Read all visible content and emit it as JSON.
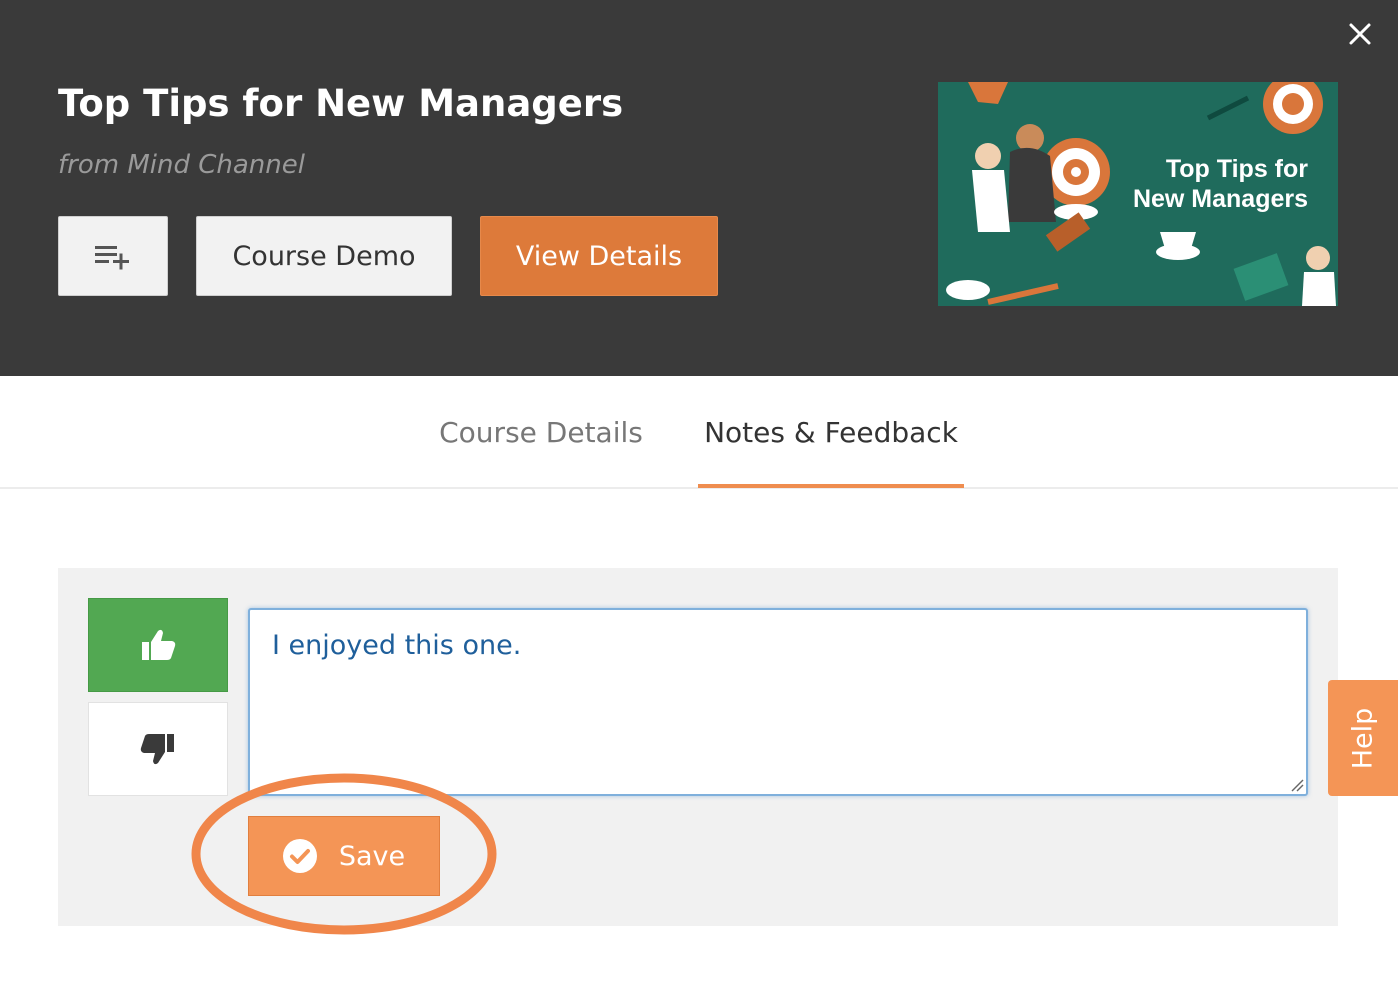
{
  "header": {
    "title": "Top Tips for New Managers",
    "source": "from Mind Channel",
    "add_to_list_icon": "playlist-add-icon",
    "demo_label": "Course Demo",
    "details_label": "View Details",
    "close_icon": "close-icon",
    "thumbnail": {
      "line1": "Top Tips for",
      "line2": "New Managers"
    }
  },
  "tabs": [
    {
      "label": "Course Details",
      "active": false
    },
    {
      "label": "Notes & Feedback",
      "active": true
    }
  ],
  "feedback": {
    "thumbs_up_icon": "thumbs-up-icon",
    "thumbs_down_icon": "thumbs-down-icon",
    "selected_vote": "up",
    "note_value": "I enjoyed this one.",
    "save_label": "Save"
  },
  "help_label": "Help",
  "colors": {
    "header_bg": "#3a3a3a",
    "accent_orange": "#dd7a3a",
    "save_orange": "#f49556",
    "vote_green": "#52a852",
    "tab_underline": "#ef8d4f",
    "input_text": "#1f5f9b",
    "thumbnail_bg": "#1f6b5c"
  }
}
